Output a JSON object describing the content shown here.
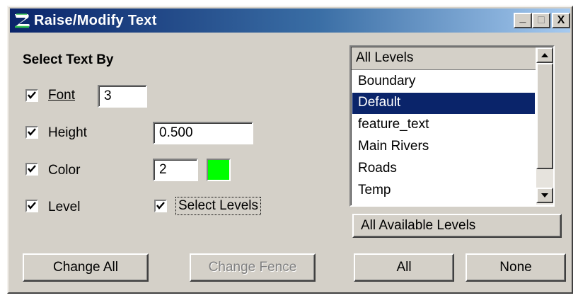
{
  "window": {
    "title": "Raise/Modify Text",
    "app_icon": "bentley-b-icon"
  },
  "titlebar_buttons": {
    "minimize": "_",
    "maximize": "□",
    "close": "X"
  },
  "select_text_by": {
    "heading": "Select Text By",
    "font": {
      "checked": true,
      "label": "Font",
      "value": "3"
    },
    "height": {
      "checked": true,
      "label": "Height",
      "value": "0.500"
    },
    "color": {
      "checked": true,
      "label": "Color",
      "value": "2",
      "swatch_color": "#00ff00"
    },
    "level": {
      "checked": true,
      "label": "Level"
    },
    "select_levels": {
      "checked": true,
      "label": "Select Levels"
    }
  },
  "levels_list": {
    "header": "All Levels",
    "items": [
      "Boundary",
      "Default",
      "feature_text",
      "Main Rivers",
      "Roads",
      "Temp"
    ],
    "selected": "Default"
  },
  "buttons": {
    "all_available_levels": "All Available Levels",
    "change_all": "Change All",
    "change_fence": "Change Fence",
    "all": "All",
    "none": "None"
  },
  "colors": {
    "titlebar_start": "#0a246a",
    "titlebar_end": "#a6caf0",
    "selection": "#0a246a",
    "face": "#d4d0c8"
  }
}
